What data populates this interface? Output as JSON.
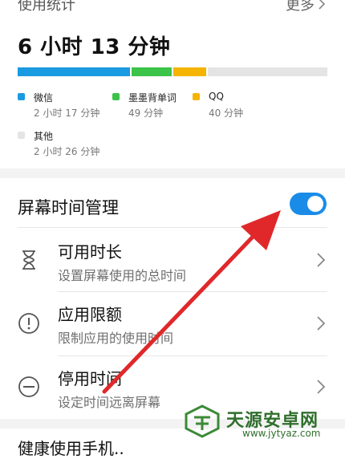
{
  "usage": {
    "title": "使用统计",
    "more_label": "更多",
    "total": "6 小时 13 分钟",
    "segments": [
      {
        "name": "微信",
        "value": "2 小时 17 分钟",
        "minutes": 137,
        "color": "#1a9ae0"
      },
      {
        "name": "墨墨背单词",
        "value": "49 分钟",
        "minutes": 49,
        "color": "#3cc34a"
      },
      {
        "name": "QQ",
        "value": "40 分钟",
        "minutes": 40,
        "color": "#f4b400"
      },
      {
        "name": "其他",
        "value": "2 小时 26 分钟",
        "minutes": 146,
        "color": "#e4e4e4"
      }
    ]
  },
  "screen_time": {
    "title": "屏幕时间管理",
    "toggle_on": true,
    "accent": "#1a8ce8",
    "items": [
      {
        "title": "可用时长",
        "subtitle": "设置屏幕使用的总时间",
        "icon": "hourglass-icon"
      },
      {
        "title": "应用限额",
        "subtitle": "限制应用的使用时间",
        "icon": "exclamation-circle-icon"
      },
      {
        "title": "停用时间",
        "subtitle": "设定时间远离屏幕",
        "icon": "minus-circle-icon"
      }
    ]
  },
  "next_section_title": "健康使用手机..",
  "annotation": {
    "arrow_color": "#e0282a"
  },
  "watermark": {
    "name": "天源安卓网",
    "url": "www.jytyaz.com"
  }
}
